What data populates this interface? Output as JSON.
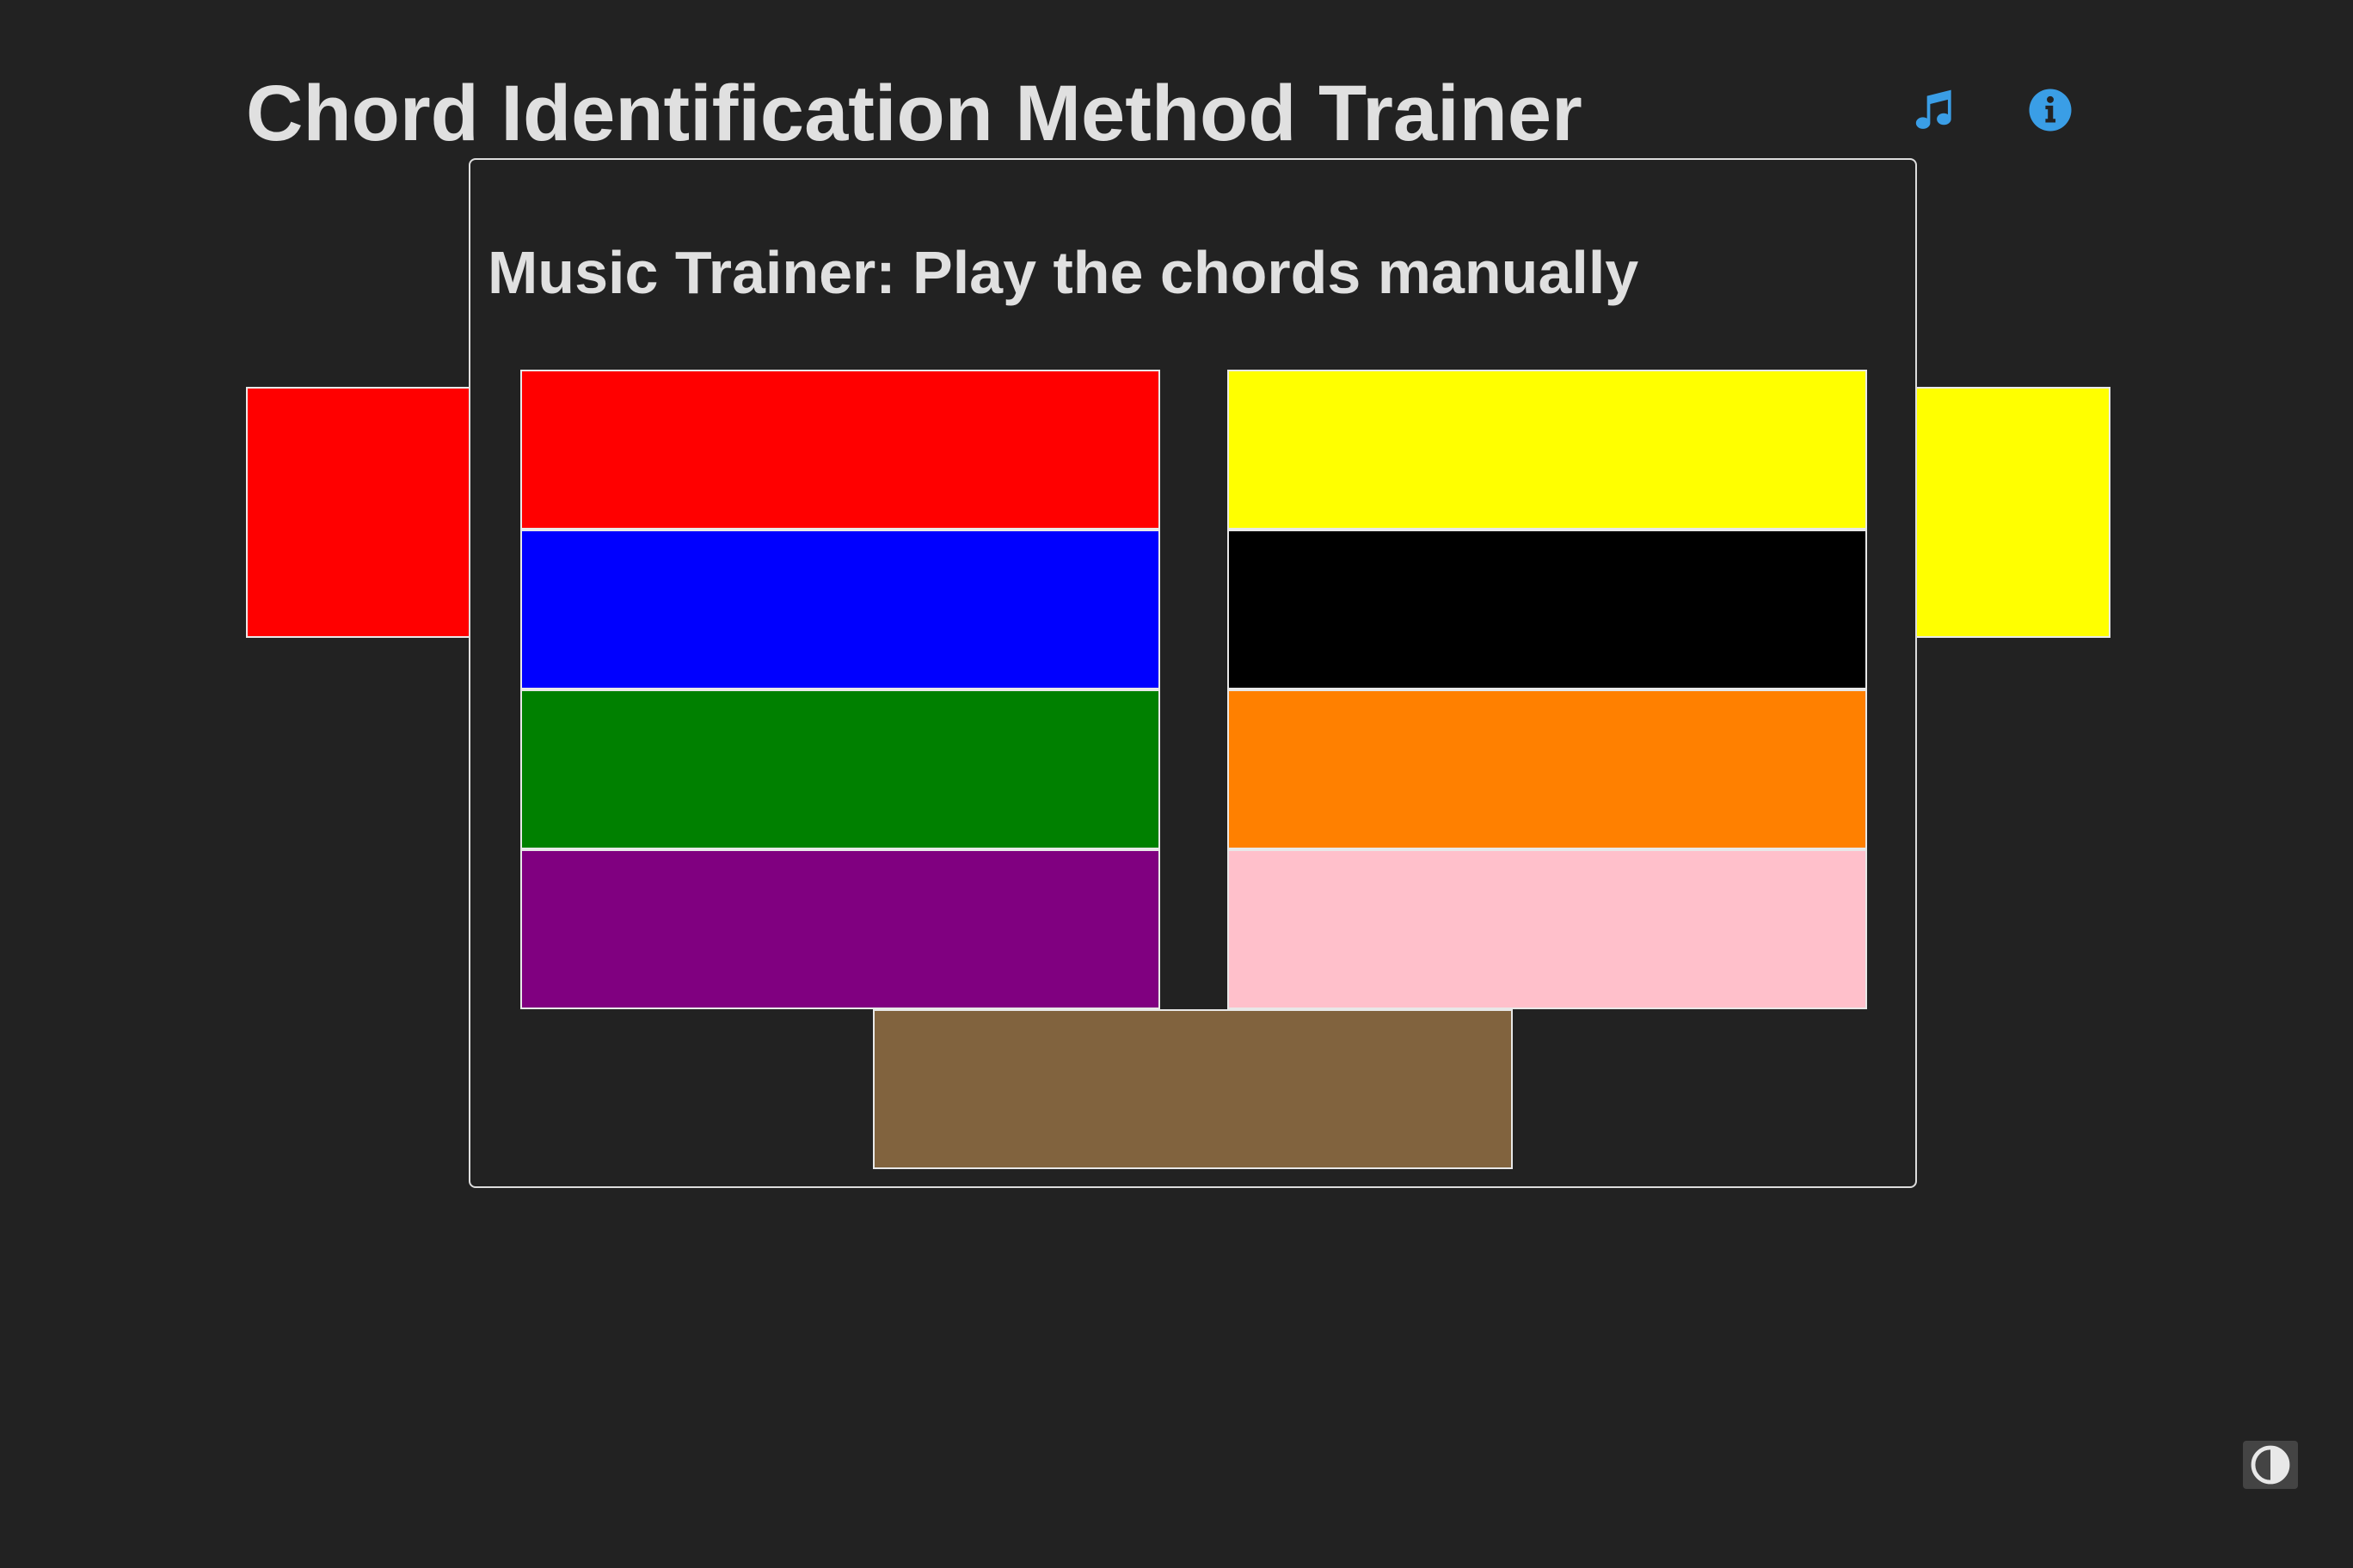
{
  "header": {
    "title": "Chord Identification Method Trainer",
    "icons": {
      "music": "music-note-icon",
      "info": "info-circle-icon"
    },
    "icon_color": "#3a9ee6"
  },
  "background_swatches": {
    "left_color": "#ff0000",
    "right_color": "#ffff00"
  },
  "modal": {
    "title": "Music Trainer: Play the chords manually",
    "chord_buttons_left": [
      {
        "color": "#ff0000",
        "name": "red"
      },
      {
        "color": "#0000ff",
        "name": "blue"
      },
      {
        "color": "#008000",
        "name": "green"
      },
      {
        "color": "#800080",
        "name": "purple"
      }
    ],
    "chord_buttons_right": [
      {
        "color": "#ffff00",
        "name": "yellow"
      },
      {
        "color": "#000000",
        "name": "black"
      },
      {
        "color": "#ff8000",
        "name": "orange"
      },
      {
        "color": "#ffc0cb",
        "name": "pink"
      }
    ],
    "chord_button_center": {
      "color": "#81633e",
      "name": "brown"
    }
  },
  "theme_toggle": {
    "icon": "contrast-icon"
  }
}
